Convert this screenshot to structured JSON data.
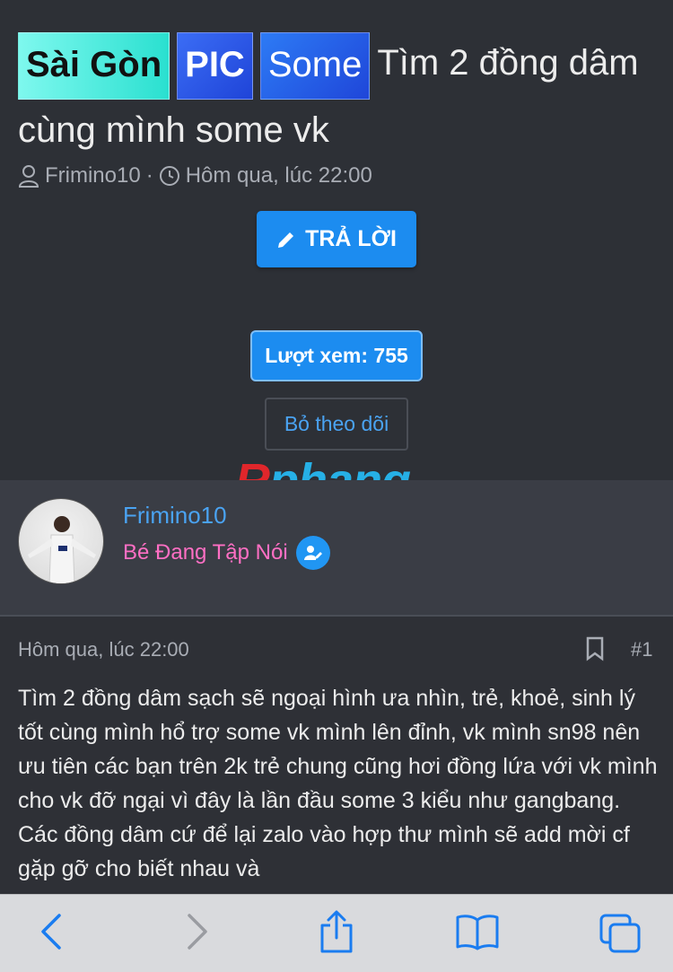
{
  "thread": {
    "tags": [
      "Sài Gòn",
      "PIC",
      "Some"
    ],
    "title": "Tìm 2 đồng dâm cùng mình some vk",
    "author": "Frimino10",
    "separator": "·",
    "time": "Hôm qua, lúc 22:00",
    "reply_label": "TRẢ LỜI",
    "views_label": "Lượt xem: 755",
    "unfollow_label": "Bỏ theo dõi"
  },
  "watermark": {
    "part1": "R",
    "part2": "phang"
  },
  "post": {
    "author_name": "Frimino10",
    "author_rank": "Bé Đang Tập Nói",
    "time": "Hôm qua, lúc 22:00",
    "number": "#1",
    "body": "Tìm 2 đồng dâm sạch sẽ ngoại hình ưa nhìn, trẻ, khoẻ, sinh lý tốt cùng mình hổ trợ some vk mình lên đỉnh, vk mình sn98 nên ưu tiên các bạn trên 2k trẻ chung cũng hơi đồng lứa với vk mình cho vk đỡ ngại vì đây là lần đầu some 3 kiểu như gangbang. Các đồng dâm cứ để lại zalo vào hợp thư mình sẽ add mời cf gặp gỡ cho biết nhau và"
  },
  "colors": {
    "accent": "#1c8cf0",
    "link": "#4aa3f2",
    "rank": "#ff6fc4",
    "background": "#2e3036"
  },
  "toolbar": {
    "icons": [
      "back-icon",
      "forward-icon",
      "share-icon",
      "bookmarks-icon",
      "tabs-icon"
    ]
  }
}
